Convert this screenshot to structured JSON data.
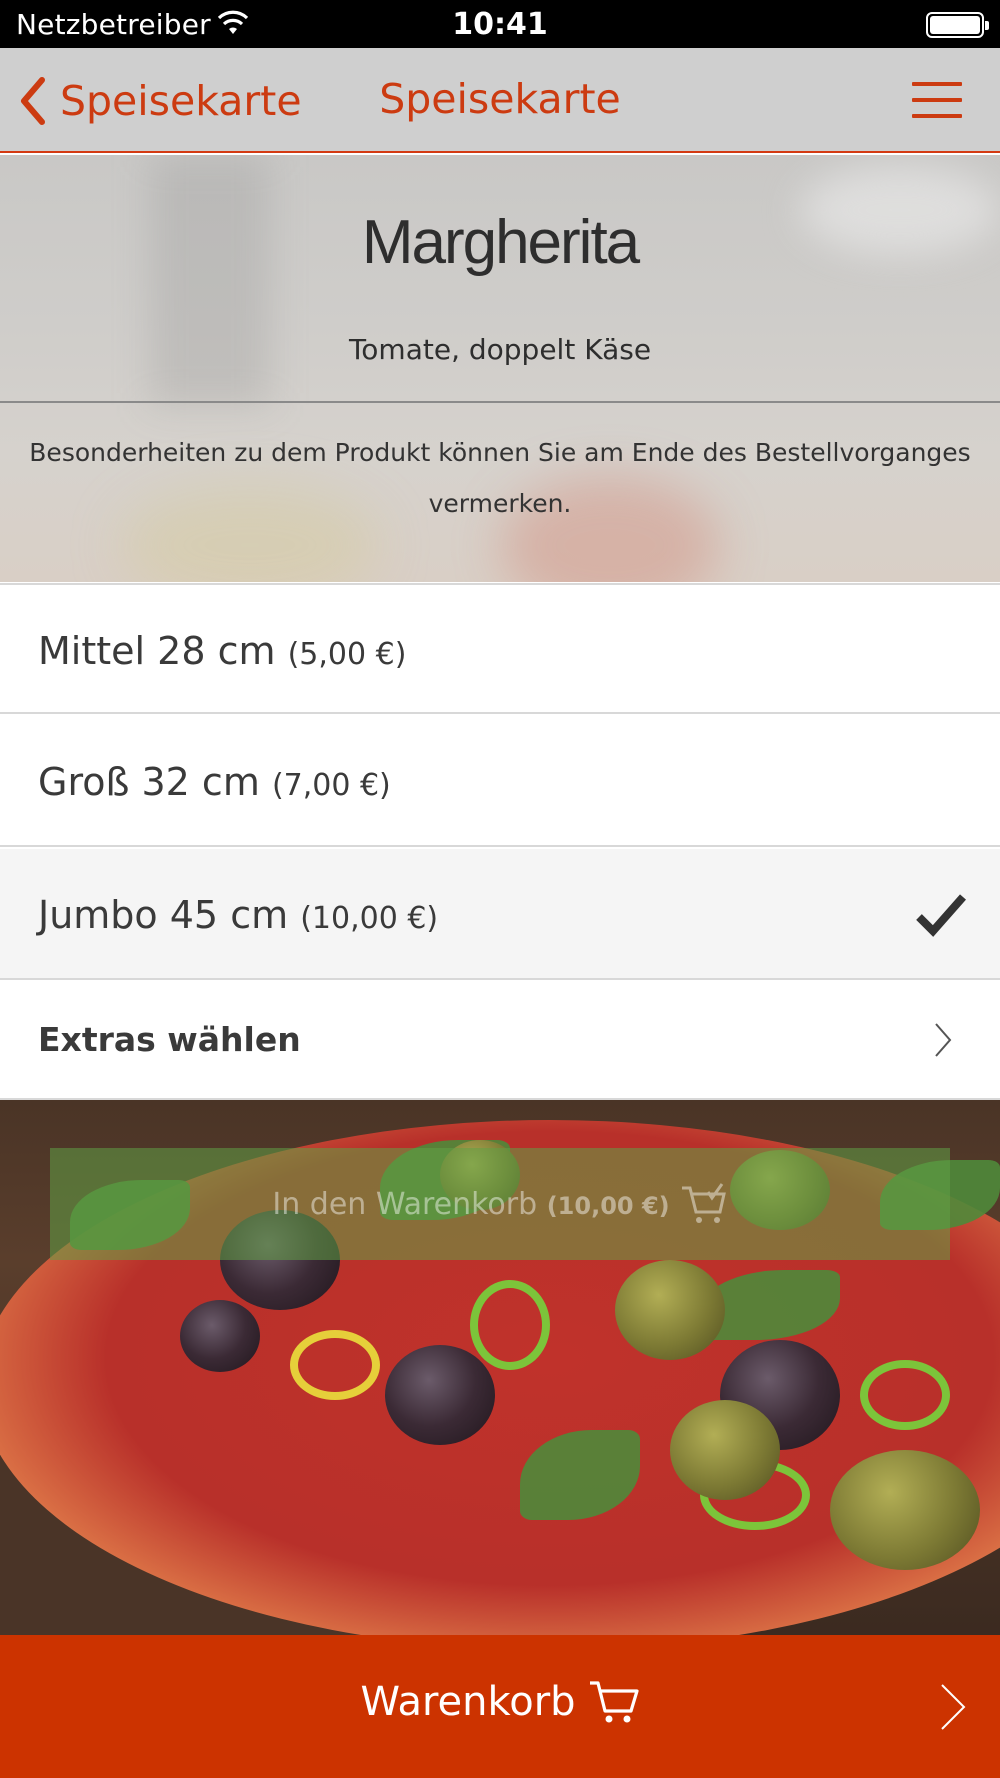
{
  "status_bar": {
    "carrier": "Netzbetreiber",
    "time": "10:41"
  },
  "nav": {
    "back_label": "Speisekarte",
    "title": "Speisekarte"
  },
  "product": {
    "name": "Margherita",
    "ingredients": "Tomate, doppelt Käse",
    "note": "Besonderheiten zu dem Produkt können Sie am Ende des Bestellvorganges vermerken."
  },
  "sizes": [
    {
      "label": "Mittel 28 cm",
      "price": "(5,00 €)",
      "selected": false
    },
    {
      "label": "Groß 32 cm",
      "price": "(7,00 €)",
      "selected": false
    },
    {
      "label": "Jumbo 45 cm",
      "price": "(10,00 €)",
      "selected": true
    }
  ],
  "extras_label": "Extras wählen",
  "add_to_cart": {
    "label": "In den Warenkorb",
    "price": "(10,00 €)"
  },
  "cart_bar": {
    "label": "Warenkorb"
  },
  "colors": {
    "accent": "#cc3300",
    "nav_text": "#cc3b11",
    "add_button": "#60a046"
  },
  "icons": [
    "wifi-icon",
    "battery-icon",
    "back-chevron-icon",
    "hamburger-menu-icon",
    "checkmark-icon",
    "chevron-right-icon",
    "cart-add-icon",
    "cart-icon"
  ]
}
